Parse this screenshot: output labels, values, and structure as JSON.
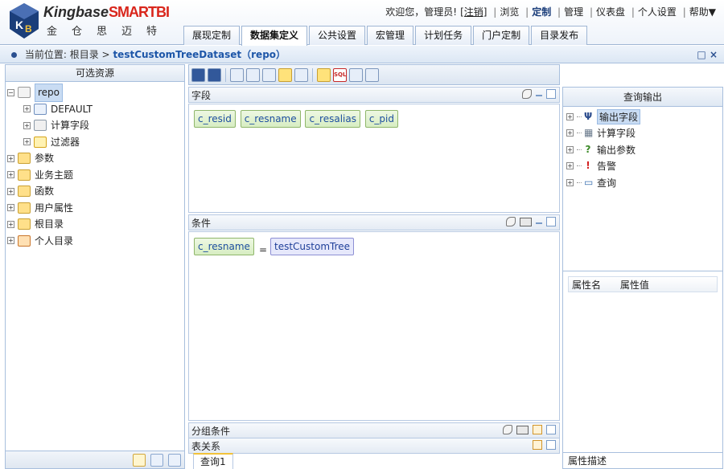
{
  "app": {
    "brand": "Kingbase",
    "brand_accent": "SMARTBI",
    "brand_cn": "金仓思迈特"
  },
  "top_links": {
    "welcome": "欢迎您，管理员!",
    "logout": "[注销]",
    "browse": "浏览",
    "customize": "定制",
    "manage": "管理",
    "dashboard": "仪表盘",
    "personal": "个人设置",
    "help": "帮助▼"
  },
  "tabs": [
    {
      "label": "展现定制"
    },
    {
      "label": "数据集定义"
    },
    {
      "label": "公共设置"
    },
    {
      "label": "宏管理"
    },
    {
      "label": "计划任务"
    },
    {
      "label": "门户定制"
    },
    {
      "label": "目录发布"
    }
  ],
  "breadcrumb": {
    "prefix": "当前位置:",
    "root": "根目录",
    "arrow": ">",
    "current": "testCustomTreeDataset（repo）",
    "window_controls": "□ ×"
  },
  "left_panel": {
    "title": "可选资源",
    "tree": [
      {
        "label": "repo",
        "exp": "−"
      },
      {
        "label": "DEFAULT",
        "exp": "+"
      },
      {
        "label": "计算字段",
        "exp": "+"
      },
      {
        "label": "过滤器",
        "exp": "+"
      },
      {
        "label": "参数",
        "exp": "+"
      },
      {
        "label": "业务主题",
        "exp": "+"
      },
      {
        "label": "函数",
        "exp": "+"
      },
      {
        "label": "用户属性",
        "exp": "+"
      },
      {
        "label": "根目录",
        "exp": "+"
      },
      {
        "label": "个人目录",
        "exp": "+"
      }
    ]
  },
  "toolbar": {
    "sql": "SQL"
  },
  "fields_section": {
    "title": "字段",
    "chips": [
      "c_resid",
      "c_resname",
      "c_resalias",
      "c_pid"
    ]
  },
  "conditions_section": {
    "title": "条件",
    "field": "c_resname",
    "operator": "=",
    "value": "testCustomTree"
  },
  "group_section": {
    "title": "分组条件"
  },
  "relations_section": {
    "title": "表关系"
  },
  "bottom_tab": {
    "label": "查询1"
  },
  "right_panel": {
    "title": "查询输出",
    "tree": [
      {
        "label": "输出字段",
        "icon": "Ψ",
        "color": "#2f4f8f"
      },
      {
        "label": "计算字段",
        "icon": "▦",
        "color": "#6a7a8c"
      },
      {
        "label": "输出参数",
        "icon": "?",
        "color": "#3c8a28"
      },
      {
        "label": "告警",
        "icon": "!",
        "color": "#d32222"
      },
      {
        "label": "查询",
        "icon": "▭",
        "color": "#3a6fb0"
      }
    ],
    "prop_name": "属性名",
    "prop_value": "属性值",
    "prop_desc": "属性描述"
  }
}
